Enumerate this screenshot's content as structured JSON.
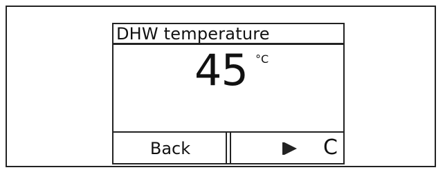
{
  "display": {
    "title": "DHW temperature",
    "value": "45",
    "unit": "°C"
  },
  "softkeys": {
    "left_label": "Back",
    "right_icon": "play-arrow-icon",
    "right_char": "C"
  }
}
